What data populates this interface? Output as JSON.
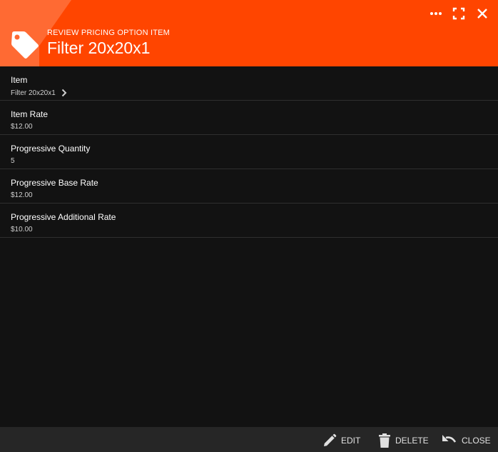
{
  "header": {
    "subtitle": "REVIEW PRICING OPTION ITEM",
    "title": "Filter 20x20x1",
    "icon": "tag-icon",
    "accent_color": "#ff4500",
    "actions": [
      {
        "name": "more-options-button",
        "icon": "more-horizontal-icon"
      },
      {
        "name": "fullscreen-button",
        "icon": "fullscreen-icon"
      },
      {
        "name": "close-x-button",
        "icon": "close-icon"
      }
    ]
  },
  "fields": [
    {
      "label": "Item",
      "value": "Filter 20x20x1",
      "link": true
    },
    {
      "label": "Item Rate",
      "value": "$12.00"
    },
    {
      "label": "Progressive Quantity",
      "value": "5"
    },
    {
      "label": "Progressive Base Rate",
      "value": "$12.00"
    },
    {
      "label": "Progressive Additional Rate",
      "value": "$10.00"
    }
  ],
  "footer": {
    "edit_label": "EDIT",
    "delete_label": "DELETE",
    "close_label": "CLOSE"
  }
}
